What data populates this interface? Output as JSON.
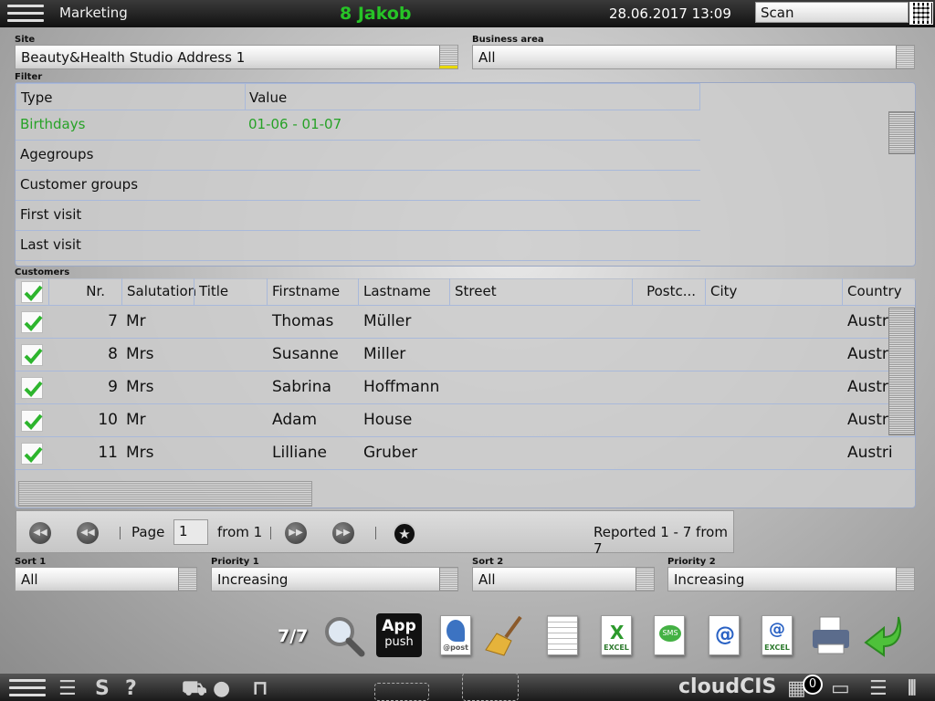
{
  "header": {
    "module": "Marketing",
    "user": "8 Jakob",
    "datetime": "28.06.2017 13:09",
    "scan_placeholder": "Scan"
  },
  "site": {
    "label": "Site",
    "value": "Beauty&Health Studio Address 1"
  },
  "business_area": {
    "label": "Business area",
    "value": "All"
  },
  "filter": {
    "label": "Filter",
    "columns": [
      "Type",
      "Value"
    ],
    "rows": [
      {
        "type": "Birthdays",
        "value": "01-06 - 01-07"
      },
      {
        "type": "Agegroups",
        "value": ""
      },
      {
        "type": "Customer groups",
        "value": ""
      },
      {
        "type": "First visit",
        "value": ""
      },
      {
        "type": "Last visit",
        "value": ""
      }
    ]
  },
  "customers": {
    "label": "Customers",
    "columns": [
      "Nr.",
      "Salutation",
      "Title",
      "Firstname",
      "Lastname",
      "Street",
      "Postc...",
      "City",
      "Country"
    ],
    "rows": [
      {
        "nr": "7",
        "salutation": "Mr",
        "title": "",
        "firstname": "Thomas",
        "lastname": "Müller",
        "country": "Austri"
      },
      {
        "nr": "8",
        "salutation": "Mrs",
        "title": "",
        "firstname": "Susanne",
        "lastname": "Miller",
        "country": "Austri"
      },
      {
        "nr": "9",
        "salutation": "Mrs",
        "title": "",
        "firstname": "Sabrina",
        "lastname": "Hoffmann",
        "country": "Austri"
      },
      {
        "nr": "10",
        "salutation": "Mr",
        "title": "",
        "firstname": "Adam",
        "lastname": "House",
        "country": "Austri"
      },
      {
        "nr": "11",
        "salutation": "Mrs",
        "title": "",
        "firstname": "Lilliane",
        "lastname": "Gruber",
        "country": "Austri"
      }
    ]
  },
  "pager": {
    "page_label": "Page",
    "page_value": "1",
    "from_label": "from 1",
    "reported": "Reported 1 - 7 from 7"
  },
  "sort1": {
    "label": "Sort 1",
    "value": "All"
  },
  "priority1": {
    "label": "Priority 1",
    "value": "Increasing"
  },
  "sort2": {
    "label": "Sort 2",
    "value": "All"
  },
  "priority2": {
    "label": "Priority 2",
    "value": "Increasing"
  },
  "toolbar": {
    "count": "7/7",
    "app_push_line1": "App",
    "app_push_line2": "push",
    "post_label": "@post",
    "excel_label": "EXCEL",
    "sms_label": "SMS",
    "email_excel_label": "EXCEL"
  },
  "footer": {
    "brand": "cloudCIS",
    "badge": "0"
  },
  "colors": {
    "accent_green": "#27c427",
    "border_blue": "#a9b9da"
  }
}
